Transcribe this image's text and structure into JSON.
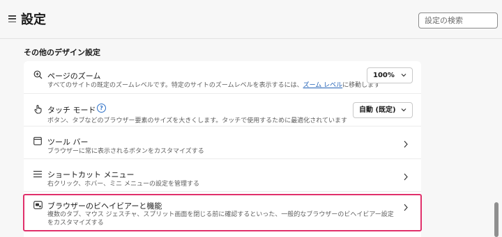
{
  "header": {
    "title": "設定",
    "search_placeholder": "設定の検索"
  },
  "section": {
    "heading": "その他のデザイン設定"
  },
  "rows": [
    {
      "title": "ページのズーム",
      "desc_before": "すべてのサイトの既定のズームレベルです。特定のサイトのズームレベルを表示するには、",
      "desc_link": "ズーム レベル",
      "desc_after": "に移動します",
      "control": "100%",
      "icon": "zoom-in-icon"
    },
    {
      "title": "タッチ モード",
      "help": "?",
      "desc": "ボタン、タブなどのブラウザー要素のサイズを大きくします。タッチで使用するために最適化されています",
      "control": "自動 (既定)",
      "icon": "touch-icon"
    },
    {
      "title": "ツール バー",
      "desc": "ブラウザーに常に表示されるボタンをカスタマイズする",
      "icon": "toolbar-icon"
    },
    {
      "title": "ショートカット メニュー",
      "desc": "右クリック、ホバー、ミニ メニューの設定を管理する",
      "icon": "menu-icon"
    },
    {
      "title": "ブラウザーのビヘイビアーと機能",
      "desc": "複数のタブ、マウス ジェスチャ、スプリット画面を閉じる前に確認するといった、一般的なブラウザーのビヘイビアー設定をカスタマイズする",
      "icon": "browser-behavior-icon"
    }
  ],
  "colors": {
    "highlight": "#e0306b",
    "link": "#1f5fb5"
  }
}
